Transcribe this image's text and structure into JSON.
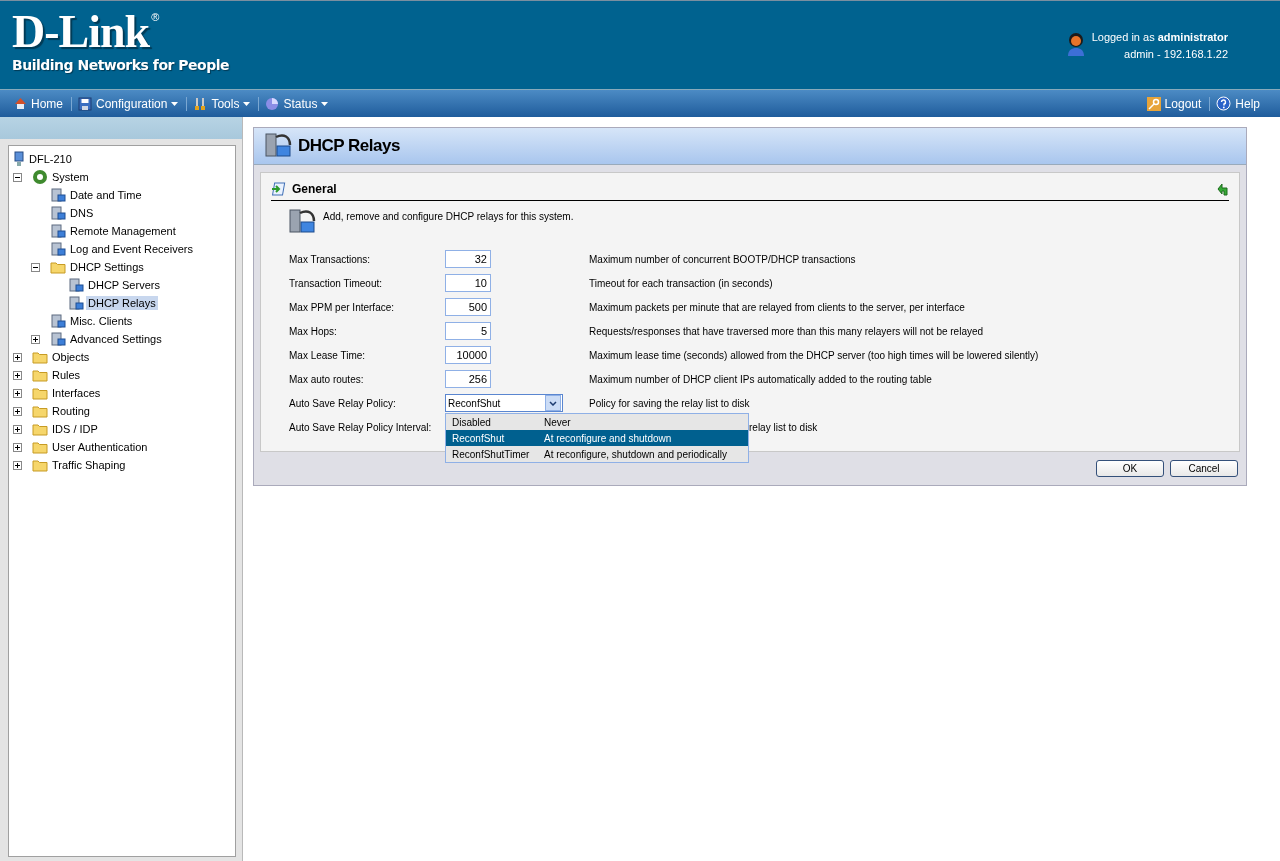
{
  "header": {
    "logo": "D-Link",
    "registered": "®",
    "tagline": "Building Networks for People",
    "login_prefix": "Logged in as ",
    "login_user": "administrator",
    "session": "admin - 192.168.1.22"
  },
  "menu": [
    {
      "label": "Home",
      "dropdown": false
    },
    {
      "label": "Configuration",
      "dropdown": true
    },
    {
      "label": "Tools",
      "dropdown": true
    },
    {
      "label": "Status",
      "dropdown": true
    }
  ],
  "menu_right": [
    {
      "label": "Logout"
    },
    {
      "label": "Help"
    }
  ],
  "tree": [
    {
      "label": "DFL-210",
      "kind": "device",
      "selected": false,
      "children": [
        {
          "label": "System",
          "kind": "gear",
          "expanded": true,
          "selected": false,
          "children": [
            {
              "label": "Date and Time",
              "kind": "item",
              "selected": false
            },
            {
              "label": "DNS",
              "kind": "item",
              "selected": false
            },
            {
              "label": "Remote Management",
              "kind": "item",
              "selected": false
            },
            {
              "label": "Log and Event Receivers",
              "kind": "item",
              "selected": false
            },
            {
              "label": "DHCP Settings",
              "kind": "folder",
              "expanded": true,
              "selected": false,
              "children": [
                {
                  "label": "DHCP Servers",
                  "kind": "item",
                  "selected": false
                },
                {
                  "label": "DHCP Relays",
                  "kind": "item",
                  "selected": true
                }
              ]
            },
            {
              "label": "Misc. Clients",
              "kind": "item",
              "selected": false
            },
            {
              "label": "Advanced Settings",
              "kind": "item",
              "expanded": false,
              "selected": false
            }
          ]
        },
        {
          "label": "Objects",
          "kind": "folder",
          "expanded": false,
          "selected": false
        },
        {
          "label": "Rules",
          "kind": "folder",
          "expanded": false,
          "selected": false
        },
        {
          "label": "Interfaces",
          "kind": "folder",
          "expanded": false,
          "selected": false
        },
        {
          "label": "Routing",
          "kind": "folder",
          "expanded": false,
          "selected": false
        },
        {
          "label": "IDS / IDP",
          "kind": "folder",
          "expanded": false,
          "selected": false
        },
        {
          "label": "User Authentication",
          "kind": "folder",
          "expanded": false,
          "selected": false
        },
        {
          "label": "Traffic Shaping",
          "kind": "folder",
          "expanded": false,
          "selected": false
        }
      ]
    }
  ],
  "page": {
    "title": "DHCP Relays",
    "section": "General",
    "intro": "Add, remove and configure DHCP relays for this system."
  },
  "fields": [
    {
      "kind": "number",
      "label": "Max Transactions:",
      "value": "32",
      "description": "Maximum number of concurrent BOOTP/DHCP transactions"
    },
    {
      "kind": "number",
      "label": "Transaction Timeout:",
      "value": "10",
      "description": "Timeout for each transaction (in seconds)"
    },
    {
      "kind": "number",
      "label": "Max PPM per Interface:",
      "value": "500",
      "description": "Maximum packets per minute that are relayed from clients to the server, per interface"
    },
    {
      "kind": "number",
      "label": "Max Hops:",
      "value": "5",
      "description": "Requests/responses that have traversed more than this many relayers will not be relayed"
    },
    {
      "kind": "number",
      "label": "Max Lease Time:",
      "value": "10000",
      "description": "Maximum lease time (seconds) allowed from the DHCP server (too high times will be lowered silently)"
    },
    {
      "kind": "number",
      "label": "Max auto routes:",
      "value": "256",
      "description": "Maximum number of DHCP client IPs automatically added to the routing table"
    },
    {
      "kind": "select",
      "label": "Auto Save Relay Policy:",
      "value": "ReconfShut",
      "description": "Policy for saving the relay list to disk",
      "expanded": true,
      "options": [
        {
          "value": "Disabled",
          "meaning": "Never",
          "selected": false
        },
        {
          "value": "ReconfShut",
          "meaning": "At reconfigure and shutdown",
          "selected": true
        },
        {
          "value": "ReconfShutTimer",
          "meaning": "At reconfigure, shutdown and periodically",
          "selected": false
        }
      ]
    },
    {
      "kind": "covered",
      "label": "Auto Save Relay Policy Interval:",
      "description": "relay list to disk"
    }
  ],
  "buttons": [
    {
      "label": "OK"
    },
    {
      "label": "Cancel"
    }
  ]
}
